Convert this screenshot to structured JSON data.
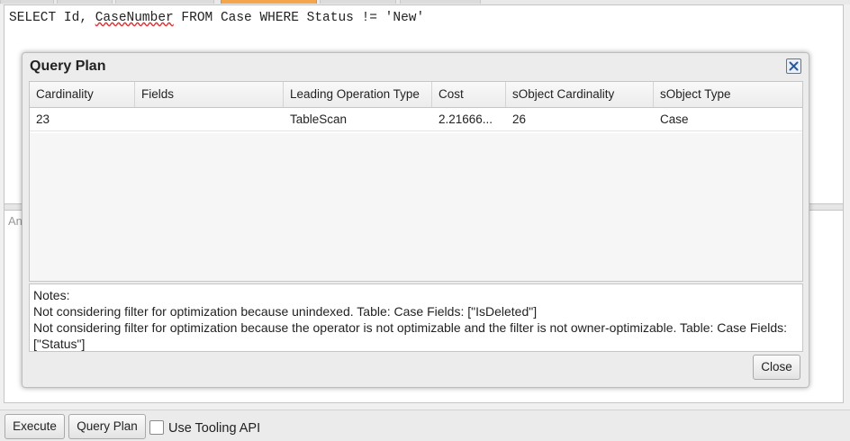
{
  "editor": {
    "query_part1": "SELECT Id, ",
    "query_squiggle": "CaseNumber",
    "query_part2": " FROM Case WHERE Status != 'New'"
  },
  "results": {
    "placeholder": "An"
  },
  "dialog": {
    "title": "Query Plan",
    "close_icon": "close-x-icon",
    "columns": [
      "Cardinality",
      "Fields",
      "Leading Operation Type",
      "Cost",
      "sObject Cardinality",
      "sObject Type"
    ],
    "rows": [
      [
        "23",
        "",
        "TableScan",
        "2.21666...",
        "26",
        "Case"
      ]
    ],
    "notes": [
      "Notes:",
      "Not considering filter for optimization because unindexed. Table: Case Fields: [\"IsDeleted\"]",
      "Not considering filter for optimization because the operator is not optimizable and the filter is not owner-optimizable. Table: Case Fields: [\"Status\"]"
    ],
    "close_button_label": "Close"
  },
  "toolbar": {
    "execute_label": "Execute",
    "query_plan_label": "Query Plan",
    "use_tooling_api_label": "Use Tooling API",
    "use_tooling_api_checked": false
  },
  "colors": {
    "active_tab": "#f3a64b",
    "close_icon_border": "#4a78b5",
    "squiggle": "#dd3333"
  }
}
